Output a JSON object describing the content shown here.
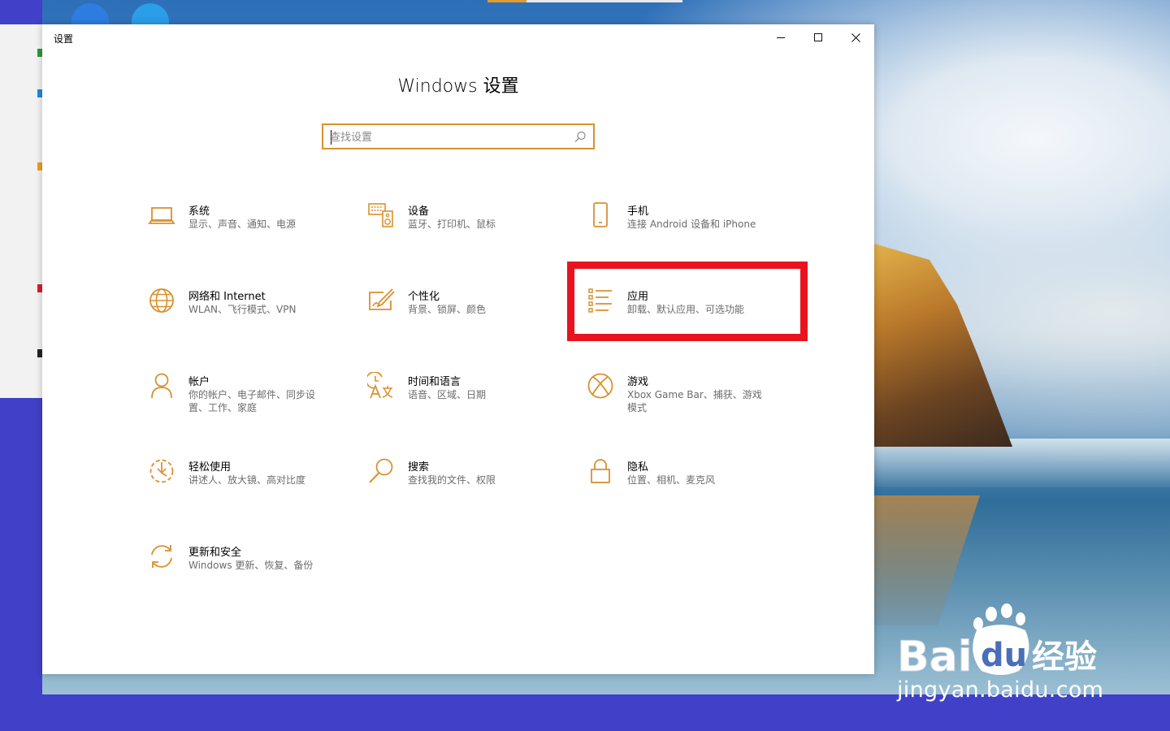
{
  "window": {
    "title": "设置",
    "minimize_icon": "minimize-icon",
    "maximize_icon": "maximize-icon",
    "close_icon": "close-icon"
  },
  "heading": "Windows 设置",
  "search": {
    "placeholder": "查找设置",
    "icon": "search-icon"
  },
  "accent_color": "#d8912f",
  "highlight_color": "#e8131f",
  "categories": [
    {
      "id": "system",
      "icon": "laptop-icon",
      "name": "系统",
      "desc": "显示、声音、通知、电源"
    },
    {
      "id": "devices",
      "icon": "keyboard-speaker-icon",
      "name": "设备",
      "desc": "蓝牙、打印机、鼠标"
    },
    {
      "id": "phone",
      "icon": "phone-icon",
      "name": "手机",
      "desc": "连接 Android 设备和 iPhone"
    },
    {
      "id": "network",
      "icon": "globe-icon",
      "name": "网络和 Internet",
      "desc": "WLAN、飞行模式、VPN"
    },
    {
      "id": "personalization",
      "icon": "paint-brush-icon",
      "name": "个性化",
      "desc": "背景、锁屏、颜色"
    },
    {
      "id": "apps",
      "icon": "apps-list-icon",
      "name": "应用",
      "desc": "卸载、默认应用、可选功能"
    },
    {
      "id": "accounts",
      "icon": "person-icon",
      "name": "帐户",
      "desc": "你的帐户、电子邮件、同步设置、工作、家庭"
    },
    {
      "id": "time-language",
      "icon": "time-language-icon",
      "name": "时间和语言",
      "desc": "语音、区域、日期"
    },
    {
      "id": "gaming",
      "icon": "xbox-icon",
      "name": "游戏",
      "desc": "Xbox Game Bar、捕获、游戏模式"
    },
    {
      "id": "ease-of-access",
      "icon": "ease-of-access-icon",
      "name": "轻松使用",
      "desc": "讲述人、放大镜、高对比度"
    },
    {
      "id": "search",
      "icon": "magnifier-icon",
      "name": "搜索",
      "desc": "查找我的文件、权限"
    },
    {
      "id": "privacy",
      "icon": "lock-icon",
      "name": "隐私",
      "desc": "位置、相机、麦克风"
    },
    {
      "id": "update-security",
      "icon": "update-icon",
      "name": "更新和安全",
      "desc": "Windows 更新、恢复、备份"
    }
  ],
  "watermark": {
    "logo": "baidu-jingyan-logo",
    "logo_text": "Baidu经验",
    "url": "jingyan.baidu.com"
  }
}
